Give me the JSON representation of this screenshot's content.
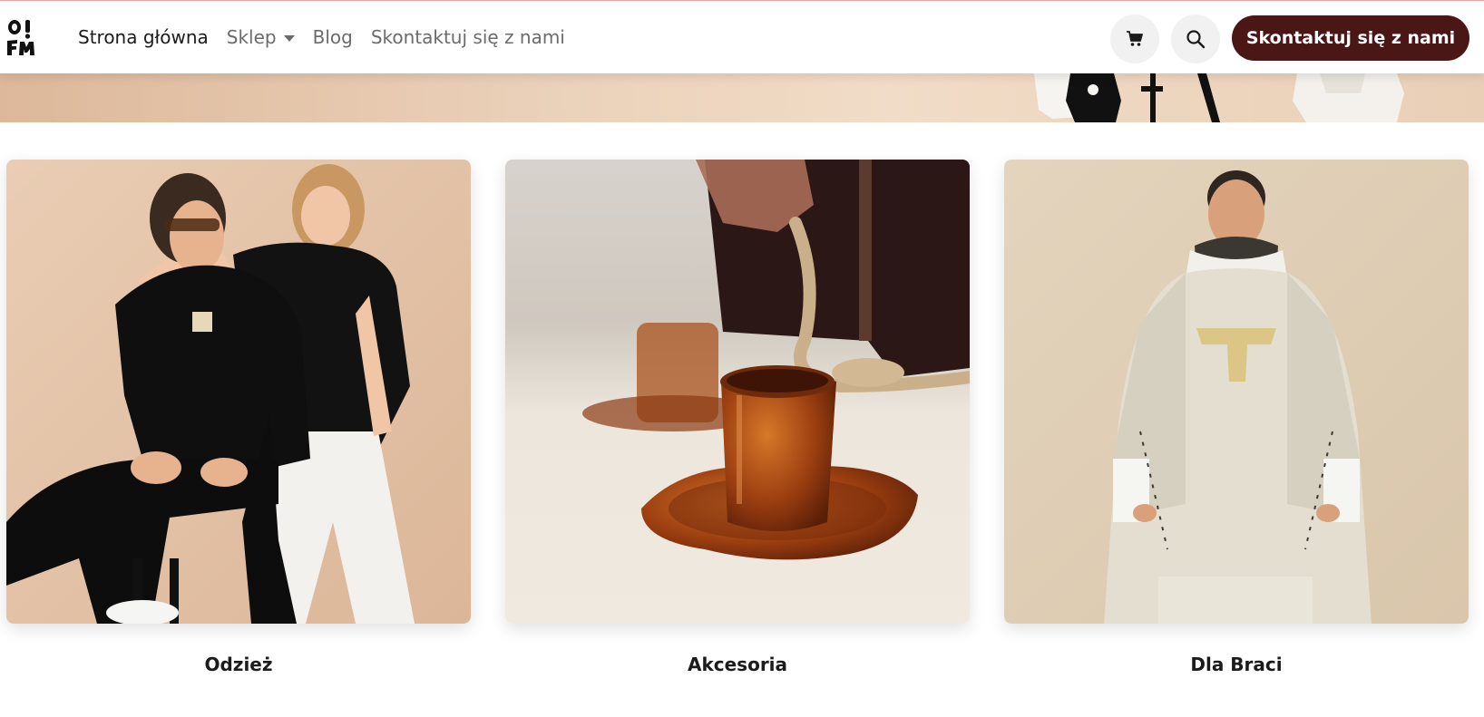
{
  "nav": {
    "logo_text": "O! FM",
    "items": [
      {
        "label": "Strona główna",
        "active": true
      },
      {
        "label": "Sklep",
        "has_dropdown": true
      },
      {
        "label": "Blog"
      },
      {
        "label": "Skontaktuj się z nami"
      }
    ],
    "cart_icon": "cart-icon",
    "search_icon": "search-icon",
    "cta_label": "Skontaktuj się z nami"
  },
  "colors": {
    "accent": "#4a1616",
    "top_line": "#e3a7a4",
    "hero_bg": "#e9cfb6",
    "icon_button_bg": "#f1f1f1"
  },
  "categories": [
    {
      "title": "Odzież"
    },
    {
      "title": "Akcesoria"
    },
    {
      "title": "Dla Braci"
    }
  ]
}
